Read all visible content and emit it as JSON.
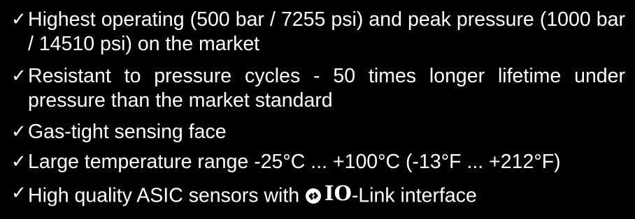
{
  "bullets": [
    {
      "check": "✓",
      "text": "Highest operating (500 bar / 7255 psi) and peak pressure (1000 bar / 14510 psi) on the market"
    },
    {
      "check": "✓",
      "text": "Resistant to pressure cycles - 50 times longer lifetime under pressure than the market standard"
    },
    {
      "check": "✓",
      "text": "Gas-tight sensing face"
    },
    {
      "check": "✓",
      "text": "Large temperature range -25°C ... +100°C (-13°F ... +212°F)"
    },
    {
      "check": "✓",
      "text_before": "High quality ASIC sensors with ",
      "io_mark": "IO",
      "text_after": "-Link interface"
    }
  ],
  "colors": {
    "background": "#000000",
    "text": "#ffffff"
  },
  "icons": {
    "io_link_logo": "io-link-logo-icon"
  }
}
